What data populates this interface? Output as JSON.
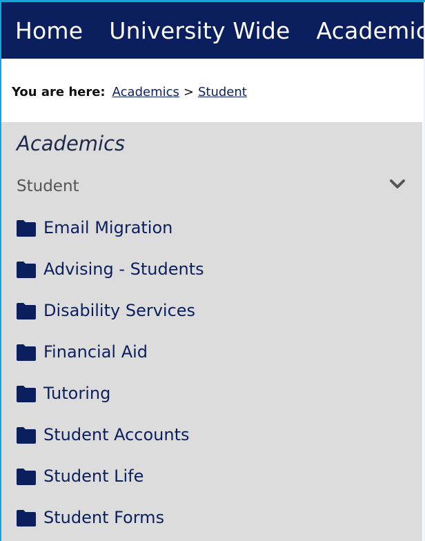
{
  "topnav": {
    "items": [
      {
        "label": "Home"
      },
      {
        "label": "University Wide"
      },
      {
        "label": "Academics"
      }
    ]
  },
  "breadcrumb": {
    "prefix": "You are here:",
    "links": [
      {
        "label": "Academics"
      },
      {
        "label": "Student"
      }
    ],
    "separator": ">"
  },
  "sidebar": {
    "title": "Academics",
    "current": "Student",
    "toggle_icon": "chevron-down-icon",
    "item_icon": "folder-icon",
    "items": [
      {
        "label": "Email Migration"
      },
      {
        "label": "Advising - Students"
      },
      {
        "label": "Disability Services"
      },
      {
        "label": "Financial Aid"
      },
      {
        "label": "Tutoring"
      },
      {
        "label": "Student Accounts"
      },
      {
        "label": "Student Life"
      },
      {
        "label": "Student Forms"
      }
    ]
  },
  "colors": {
    "nav_bg": "#0b1f5e",
    "sidebar_bg": "#dcdcdc",
    "link": "#0b1f5e",
    "page_edge": "#1aa3d6"
  }
}
